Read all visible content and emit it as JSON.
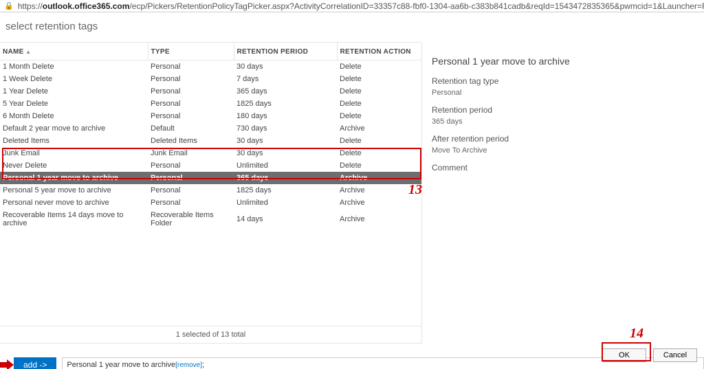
{
  "url": {
    "host_bold": "outlook.office365.com",
    "rest": "/ecp/Pickers/RetentionPolicyTagPicker.aspx?ActivityCorrelationID=33357c88-fbf0-1304-aa6b-c383b841cadb&reqId=1543472835365&pwmcid=1&Launcher=ResultPanePlaceHolder_RetentionPolicyProperties_GroupInfor..."
  },
  "title": "select retention tags",
  "columns": {
    "name": "NAME",
    "type": "TYPE",
    "period": "RETENTION PERIOD",
    "action": "RETENTION ACTION"
  },
  "rows": [
    {
      "name": "1 Month Delete",
      "type": "Personal",
      "period": "30 days",
      "action": "Delete"
    },
    {
      "name": "1 Week Delete",
      "type": "Personal",
      "period": "7 days",
      "action": "Delete"
    },
    {
      "name": "1 Year Delete",
      "type": "Personal",
      "period": "365 days",
      "action": "Delete"
    },
    {
      "name": "5 Year Delete",
      "type": "Personal",
      "period": "1825 days",
      "action": "Delete"
    },
    {
      "name": "6 Month Delete",
      "type": "Personal",
      "period": "180 days",
      "action": "Delete"
    },
    {
      "name": "Default 2 year move to archive",
      "type": "Default",
      "period": "730 days",
      "action": "Archive"
    },
    {
      "name": "Deleted Items",
      "type": "Deleted Items",
      "period": "30 days",
      "action": "Delete"
    },
    {
      "name": "Junk Email",
      "type": "Junk Email",
      "period": "30 days",
      "action": "Delete"
    },
    {
      "name": "Never Delete",
      "type": "Personal",
      "period": "Unlimited",
      "action": "Delete"
    },
    {
      "name": "Personal 1 year move to archive",
      "type": "Personal",
      "period": "365 days",
      "action": "Archive",
      "selected": true
    },
    {
      "name": "Personal 5 year move to archive",
      "type": "Personal",
      "period": "1825 days",
      "action": "Archive"
    },
    {
      "name": "Personal never move to archive",
      "type": "Personal",
      "period": "Unlimited",
      "action": "Archive"
    },
    {
      "name": "Recoverable Items 14 days move to archive",
      "type": "Recoverable Items Folder",
      "period": "14 days",
      "action": "Archive"
    }
  ],
  "status": "1 selected of 13 total",
  "add_button": "add ->",
  "added_item": "Personal 1 year move to archive",
  "remove_link": "[remove]",
  "details": {
    "heading": "Personal 1 year move to archive",
    "type_label": "Retention tag type",
    "type_value": "Personal",
    "period_label": "Retention period",
    "period_value": "365 days",
    "after_label": "After retention period",
    "after_value": "Move To Archive",
    "comment_label": "Comment"
  },
  "buttons": {
    "ok": "OK",
    "cancel": "Cancel"
  },
  "callouts": {
    "c13": "13",
    "c14": "14"
  }
}
